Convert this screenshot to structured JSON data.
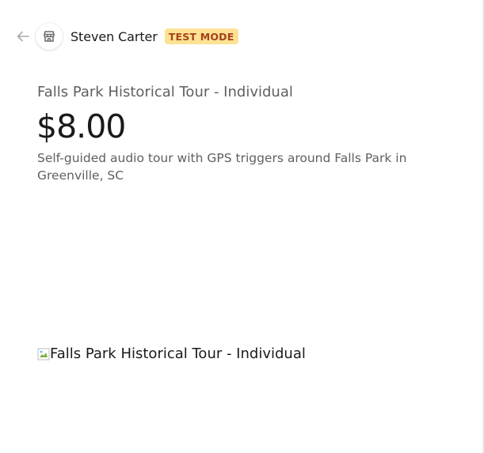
{
  "header": {
    "back_icon": "arrow-left-icon",
    "store_icon": "storefront-icon",
    "merchant_name": "Steven Carter",
    "test_mode_label": "TEST MODE"
  },
  "product": {
    "name": "Falls Park Historical Tour - Individual",
    "price": "$8.00",
    "description": "Self-guided audio tour with GPS triggers around Falls Park in Greenville, SC",
    "image_alt": "Falls Park Historical Tour - Individual"
  },
  "colors": {
    "test_badge_bg": "#fde293",
    "test_badge_text": "#a5421b",
    "primary_text": "#1a1a1a",
    "secondary_text": "#5f5f5f"
  }
}
